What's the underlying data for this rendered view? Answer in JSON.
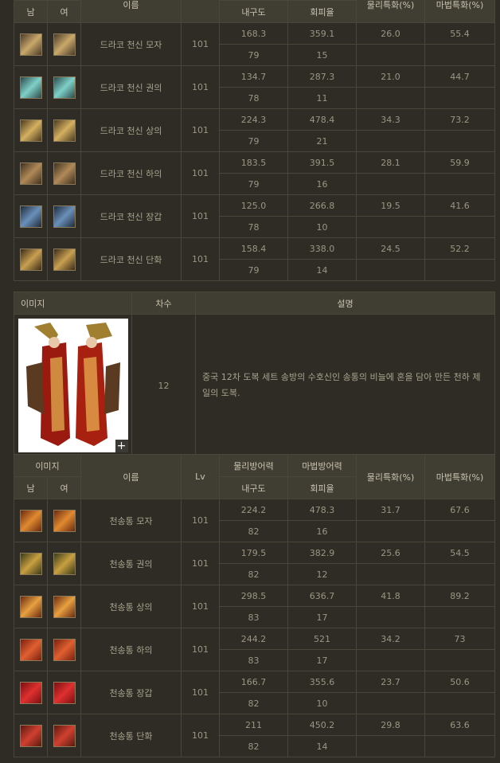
{
  "headers": {
    "image": "이미지",
    "male": "남",
    "female": "여",
    "name": "이름",
    "lv": "Lv",
    "phys_def": "물리방어력",
    "magic_def": "마법방어력",
    "phys_crit": "물리특화(%)",
    "magic_crit": "마법특화(%)",
    "durability": "내구도",
    "evasion": "회피율"
  },
  "section_headers": {
    "image": "이미지",
    "tier": "차수",
    "description": "설명"
  },
  "set_info": {
    "tier": "12",
    "description": "중국 12차 도복 세트 송방의 수호신인 송통의 비늘에 혼을 담아 만든 천하 제일의 도복.",
    "plus": "+"
  },
  "set1": [
    {
      "name": "드라코 천신 모자",
      "lv": "101",
      "phys": "168.3",
      "magic": "359.1",
      "pc": "26.0",
      "mc": "55.4",
      "dur": "79",
      "eva": "15",
      "icon_color": "#4a3a28",
      "icon_accent": "#c9a86a"
    },
    {
      "name": "드라코 천신 권의",
      "lv": "101",
      "phys": "134.7",
      "magic": "287.3",
      "pc": "21.0",
      "mc": "44.7",
      "dur": "78",
      "eva": "11",
      "icon_color": "#2a4a4a",
      "icon_accent": "#7fd0c8"
    },
    {
      "name": "드라코 천신 상의",
      "lv": "101",
      "phys": "224.3",
      "magic": "478.4",
      "pc": "34.3",
      "mc": "73.2",
      "dur": "79",
      "eva": "21",
      "icon_color": "#4a3a1e",
      "icon_accent": "#d4b060"
    },
    {
      "name": "드라코 천신 하의",
      "lv": "101",
      "phys": "183.5",
      "magic": "391.5",
      "pc": "28.1",
      "mc": "59.9",
      "dur": "79",
      "eva": "16",
      "icon_color": "#3e3020",
      "icon_accent": "#b08a58"
    },
    {
      "name": "드라코 천신 장갑",
      "lv": "101",
      "phys": "125.0",
      "magic": "266.8",
      "pc": "19.5",
      "mc": "41.6",
      "dur": "78",
      "eva": "10",
      "icon_color": "#1e2a3a",
      "icon_accent": "#6a90b8"
    },
    {
      "name": "드라코 천신 단화",
      "lv": "101",
      "phys": "158.4",
      "magic": "338.0",
      "pc": "24.5",
      "mc": "52.2",
      "dur": "79",
      "eva": "14",
      "icon_color": "#3a2a18",
      "icon_accent": "#c8a050"
    }
  ],
  "set2": [
    {
      "name": "천송통 모자",
      "lv": "101",
      "phys": "224.2",
      "magic": "478.3",
      "pc": "31.7",
      "mc": "67.6",
      "dur": "82",
      "eva": "16",
      "icon_color": "#6a2a10",
      "icon_accent": "#e08a30"
    },
    {
      "name": "천송통 권의",
      "lv": "101",
      "phys": "179.5",
      "magic": "382.9",
      "pc": "25.6",
      "mc": "54.5",
      "dur": "82",
      "eva": "12",
      "icon_color": "#3a3a18",
      "icon_accent": "#c8a040"
    },
    {
      "name": "천송통 상의",
      "lv": "101",
      "phys": "298.5",
      "magic": "636.7",
      "pc": "41.8",
      "mc": "89.2",
      "dur": "83",
      "eva": "17",
      "icon_color": "#6a2a10",
      "icon_accent": "#e8a040"
    },
    {
      "name": "천송통 하의",
      "lv": "101",
      "phys": "244.2",
      "magic": "521",
      "pc": "34.2",
      "mc": "73",
      "dur": "83",
      "eva": "17",
      "icon_color": "#7a2010",
      "icon_accent": "#e06030"
    },
    {
      "name": "천송통 장갑",
      "lv": "101",
      "phys": "166.7",
      "magic": "355.6",
      "pc": "23.7",
      "mc": "50.6",
      "dur": "82",
      "eva": "10",
      "icon_color": "#7a1010",
      "icon_accent": "#e03030"
    },
    {
      "name": "천송통 단화",
      "lv": "101",
      "phys": "211",
      "magic": "450.2",
      "pc": "29.8",
      "mc": "63.6",
      "dur": "82",
      "eva": "14",
      "icon_color": "#5a1a10",
      "icon_accent": "#d04030"
    }
  ]
}
